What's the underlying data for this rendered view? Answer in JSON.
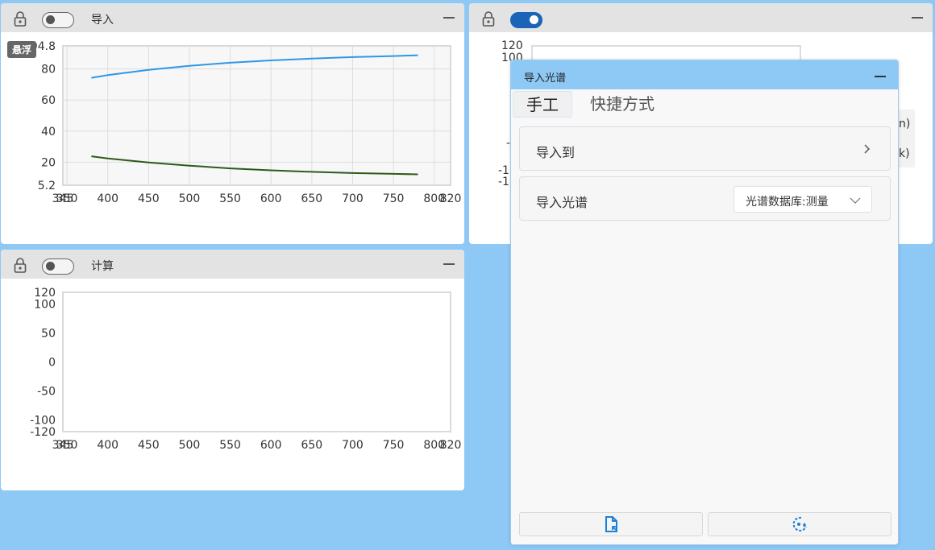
{
  "panels": {
    "import_panel": {
      "title": "导入",
      "toggle_on": false,
      "hover_badge": "悬浮"
    },
    "calc_panel": {
      "title": "计算",
      "toggle_on": false
    },
    "right_panel": {
      "toggle_on": true,
      "peek": [
        "120",
        "100",
        "-1",
        "-10",
        "-12",
        "n)",
        "k)"
      ]
    }
  },
  "dialog": {
    "title": "导入光谱",
    "tabs": [
      "手工",
      "快捷方式"
    ],
    "rows": [
      {
        "label": "导入到"
      },
      {
        "label": "导入光谱",
        "select_value": "光谱数据库:测量"
      }
    ]
  },
  "chart_data": [
    {
      "type": "line",
      "xlim": [
        345,
        820
      ],
      "ylim": [
        5.2,
        94.8
      ],
      "x_ticks": [
        "345",
        "350",
        "400",
        "450",
        "500",
        "550",
        "600",
        "650",
        "700",
        "750",
        "800",
        "820"
      ],
      "y_ticks": [
        "94.8",
        "80",
        "60",
        "40",
        "20",
        "5.2"
      ],
      "grid": true,
      "series": [
        {
          "color": "#2f97e6",
          "x": [
            380,
            400,
            450,
            500,
            550,
            600,
            650,
            700,
            750,
            780
          ],
          "y": [
            74.3,
            76.0,
            79.4,
            82.0,
            84.0,
            85.5,
            86.6,
            87.6,
            88.3,
            88.8
          ]
        },
        {
          "color": "#2c5a1a",
          "x": [
            380,
            400,
            450,
            500,
            550,
            600,
            650,
            700,
            750,
            780
          ],
          "y": [
            23.8,
            22.4,
            19.8,
            17.8,
            16.0,
            14.8,
            13.8,
            13.0,
            12.5,
            12.2
          ]
        }
      ]
    },
    {
      "type": "line",
      "xlim": [
        345,
        820
      ],
      "ylim": [
        -120,
        120
      ],
      "x_ticks": [
        "345",
        "350",
        "400",
        "450",
        "500",
        "550",
        "600",
        "650",
        "700",
        "750",
        "800",
        "820"
      ],
      "y_ticks": [
        "120",
        "100",
        "50",
        "0",
        "-50",
        "-100",
        "-120"
      ],
      "grid": false,
      "series": []
    }
  ]
}
